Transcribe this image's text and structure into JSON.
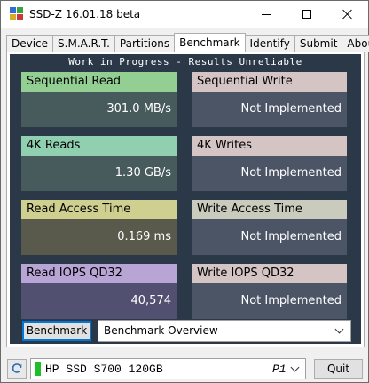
{
  "window": {
    "title": "SSD-Z 16.01.18 beta"
  },
  "tabs": [
    {
      "label": "Device"
    },
    {
      "label": "S.M.A.R.T."
    },
    {
      "label": "Partitions"
    },
    {
      "label": "Benchmark",
      "active": true
    },
    {
      "label": "Identify"
    },
    {
      "label": "Submit"
    },
    {
      "label": "About"
    }
  ],
  "benchmark": {
    "banner": "Work in Progress - Results Unreliable",
    "cards": [
      {
        "label": "Sequential Read",
        "value": "301.0 MB/s",
        "head_color": "#93cf93",
        "body_color": "#475a5c"
      },
      {
        "label": "Sequential Write",
        "value": "Not Implemented",
        "head_color": "#d4c4c4",
        "body_color": "#4c5566"
      },
      {
        "label": "4K Reads",
        "value": "1.30 GB/s",
        "head_color": "#90cfb0",
        "body_color": "#475a5c"
      },
      {
        "label": "4K Writes",
        "value": "Not Implemented",
        "head_color": "#d4c4c4",
        "body_color": "#4c5566"
      },
      {
        "label": "Read Access Time",
        "value": "0.169 ms",
        "head_color": "#cfcf90",
        "body_color": "#5a5a4c"
      },
      {
        "label": "Write Access Time",
        "value": "Not Implemented",
        "head_color": "#cbcbbd",
        "body_color": "#4c5566"
      },
      {
        "label": "Read IOPS QD32",
        "value": "40,574",
        "head_color": "#b9a5d5",
        "body_color": "#515070"
      },
      {
        "label": "Write IOPS QD32",
        "value": "Not Implemented",
        "head_color": "#d4c4c4",
        "body_color": "#4c5566"
      }
    ],
    "button_label": "Benchmark",
    "view_select": "Benchmark Overview"
  },
  "footer": {
    "drive_name": "HP SSD S700 120GB",
    "drive_port": "P1",
    "quit_label": "Quit"
  },
  "icons": {
    "app": "ssdz-app-icon",
    "refresh": "refresh-icon",
    "dropdown": "chevron-down-icon"
  }
}
